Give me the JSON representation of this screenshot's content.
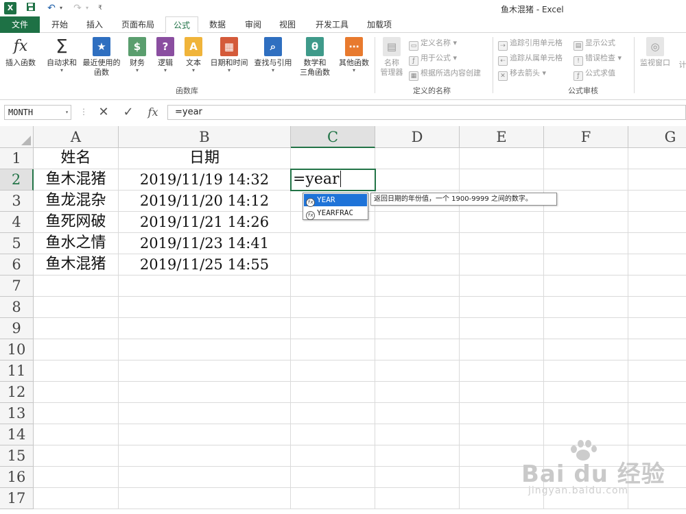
{
  "window": {
    "title": "鱼木混猪 - Excel"
  },
  "quick_access": {
    "logo": "X",
    "save": "💾",
    "undo": "↶",
    "redo": "↷",
    "dropdown": "▾",
    "customize": "₹"
  },
  "tabs": [
    "文件",
    "开始",
    "插入",
    "页面布局",
    "公式",
    "数据",
    "审阅",
    "视图",
    "开发工具",
    "加载项"
  ],
  "active_tab": "公式",
  "ribbon": {
    "function_library": {
      "label": "函数库",
      "insert_function": "插入函数",
      "autosum": "自动求和",
      "recent_1": "最近使用的",
      "recent_2": "函数",
      "financial": "财务",
      "logical": "逻辑",
      "text": "文本",
      "datetime": "日期和时间",
      "lookup": "查找与引用",
      "math_1": "数学和",
      "math_2": "三角函数",
      "more": "其他函数"
    },
    "defined_names": {
      "label": "定义的名称",
      "manager_1": "名称",
      "manager_2": "管理器",
      "define": "定义名称",
      "use_in_formula": "用于公式",
      "create_from_selection": "根据所选内容创建"
    },
    "formula_auditing": {
      "label": "公式审核",
      "trace_precedents": "追踪引用单元格",
      "trace_dependents": "追踪从属单元格",
      "remove_arrows": "移去箭头",
      "show_formulas": "显示公式",
      "error_checking": "错误检查",
      "evaluate_formula": "公式求值",
      "watch_window": "监视窗口",
      "calc_partial": "计"
    }
  },
  "formula_bar": {
    "name_box": "MONTH",
    "cancel": "✕",
    "enter": "✓",
    "fx": "fx",
    "content": "=year"
  },
  "columns": [
    "A",
    "B",
    "C",
    "D",
    "E",
    "F",
    "G"
  ],
  "rows": [
    "1",
    "2",
    "3",
    "4",
    "5",
    "6",
    "7",
    "8",
    "9",
    "10",
    "11",
    "12",
    "13",
    "14",
    "15",
    "16",
    "17"
  ],
  "sheet": {
    "header": {
      "a": "姓名",
      "b": "日期"
    },
    "data": [
      {
        "name": "鱼木混猪",
        "date": "2019/11/19  14:32"
      },
      {
        "name": "鱼龙混杂",
        "date": "2019/11/20  14:12"
      },
      {
        "name": "鱼死网破",
        "date": "2019/11/21  14:26"
      },
      {
        "name": "鱼水之情",
        "date": "2019/11/23  14:41"
      },
      {
        "name": "鱼木混猪",
        "date": "2019/11/25  14:55"
      }
    ],
    "active_cell_text": "=year"
  },
  "autocomplete": {
    "items": [
      "YEAR",
      "YEARFRAC"
    ],
    "selected": "YEAR",
    "tooltip": "返回日期的年份值，一个 1900-9999 之间的数字。",
    "icon": "fx"
  },
  "watermark": {
    "brand": "Bai du 经验",
    "url": "jingyan.baidu.com"
  },
  "colors": {
    "excel_green": "#1e7145",
    "selection_blue": "#1e73d8"
  }
}
